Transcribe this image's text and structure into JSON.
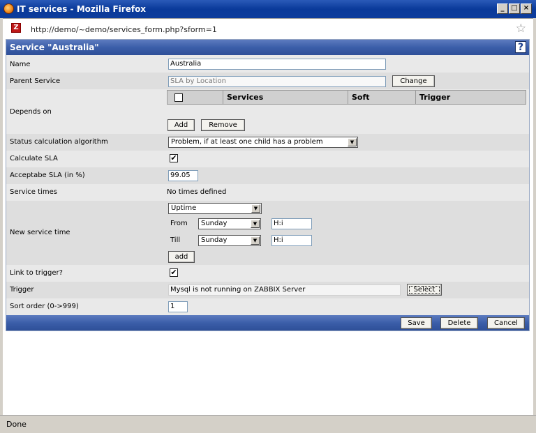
{
  "window": {
    "title": "IT services - Mozilla Firefox",
    "minimize_glyph": "_",
    "maximize_glyph": "□",
    "close_glyph": "×"
  },
  "address_bar": {
    "url": "http://demo/~demo/services_form.php?sform=1",
    "favicon_letter": "Z",
    "bookmark_icon": "star-icon"
  },
  "form": {
    "title": "Service \"Australia\"",
    "help_label": "?",
    "name": {
      "label": "Name",
      "value": "Australia"
    },
    "parent_service": {
      "label": "Parent Service",
      "value": "SLA by Location",
      "change_label": "Change"
    },
    "depends_on": {
      "label": "Depends on",
      "columns": [
        "Services",
        "Soft",
        "Trigger"
      ],
      "add_label": "Add",
      "remove_label": "Remove"
    },
    "status_algorithm": {
      "label": "Status calculation algorithm",
      "selected": "Problem, if at least one child has a problem"
    },
    "calculate_sla": {
      "label": "Calculate SLA",
      "checked": true,
      "check_glyph": "✔"
    },
    "acceptable_sla": {
      "label": "Acceptabe SLA (in %)",
      "value": "99.05"
    },
    "service_times": {
      "label": "Service times",
      "value": "No times defined"
    },
    "new_service_time": {
      "label": "New service time",
      "type_selected": "Uptime",
      "from_label": "From",
      "from_day": "Sunday",
      "from_time": "H:i",
      "till_label": "Till",
      "till_day": "Sunday",
      "till_time": "H:i",
      "add_label": "add"
    },
    "link_to_trigger": {
      "label": "Link to trigger?",
      "checked": true,
      "check_glyph": "✔"
    },
    "trigger": {
      "label": "Trigger",
      "value": "Mysql is not running on ZABBIX Server",
      "select_label": "Select"
    },
    "sort_order": {
      "label": "Sort order (0->999)",
      "value": "1"
    },
    "footer": {
      "save_label": "Save",
      "delete_label": "Delete",
      "cancel_label": "Cancel"
    }
  },
  "status_bar": {
    "text": "Done"
  },
  "colors": {
    "header_blue": "#3b5ea9",
    "title_blue": "#0a3a9a",
    "row_alt": "#dedede"
  }
}
